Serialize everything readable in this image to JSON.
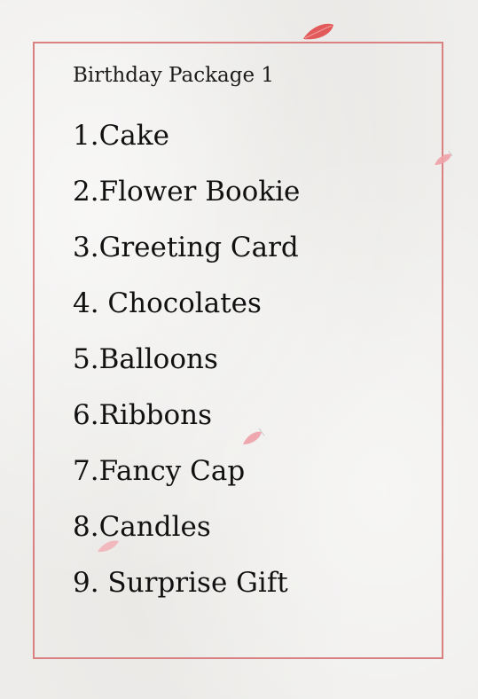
{
  "document": {
    "title": "Birthday Package 1",
    "items": [
      "1.Cake",
      "2.Flower Bookie",
      "3.Greeting Card",
      "4. Chocolates",
      "5.Balloons",
      "6.Ribbons",
      "7.Fancy Cap",
      "8.Candles",
      "9. Surprise Gift"
    ]
  },
  "colors": {
    "border": "#d98080",
    "petal": "#e35a5a",
    "text": "#111111",
    "paper": "#efeeec"
  }
}
